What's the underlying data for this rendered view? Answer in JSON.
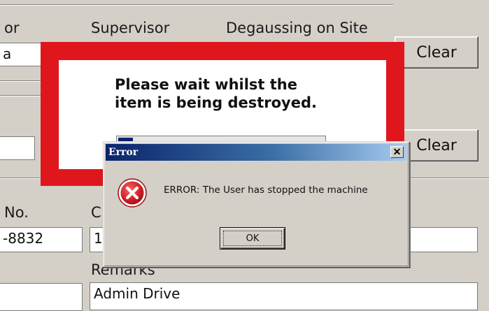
{
  "labels": {
    "operator_partial": "or",
    "supervisor": "Supervisor",
    "degaussing": "Degaussing on Site",
    "serial_partial": "No.",
    "category_partial": "C",
    "remarks": "Remarks"
  },
  "fields": {
    "operator_partial_value": "a",
    "serial_partial_value": "-8832",
    "category_partial_value": "1",
    "remarks_value": "Admin Drive"
  },
  "buttons": {
    "clear_top": "Clear",
    "clear_mid": "Clear"
  },
  "overlay": {
    "message_line1": "Please wait whilst the",
    "message_line2": "item is being destroyed.",
    "progress": 0.07
  },
  "dialog": {
    "title": "Error",
    "close_glyph": "✕",
    "message": "ERROR: The User has stopped the machine",
    "ok_label": "OK",
    "icon": "error-icon"
  },
  "colors": {
    "overlay_red": "#e0161d",
    "title_blue": "#0a246a",
    "error_red": "#d9232a"
  }
}
